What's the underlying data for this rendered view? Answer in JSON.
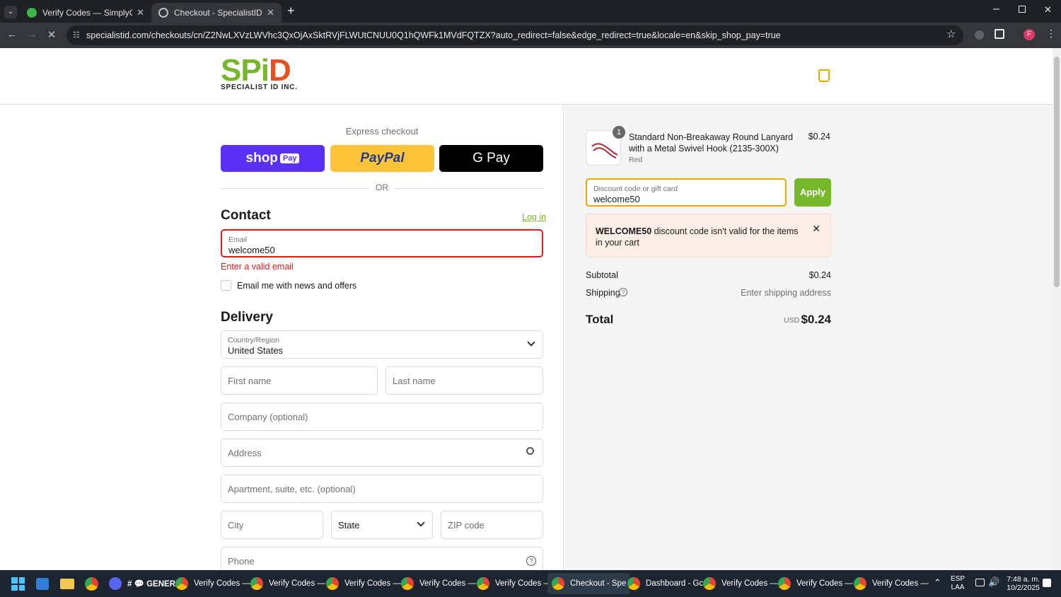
{
  "browser": {
    "tabs": [
      {
        "title": "Verify Codes — SimplyCodes",
        "close": "✕"
      },
      {
        "title": "Checkout - SpecialistID.com",
        "close": "✕"
      }
    ],
    "new_tab": "+",
    "url": "specialistid.com/checkouts/cn/Z2NwLXVzLWVhc3QxOjAxSktRVjFLWUtCNUU0Q1hQWFk1MVdFQTZX?auto_redirect=false&edge_redirect=true&locale=en&skip_shop_pay=true",
    "profile_initial": "F"
  },
  "header": {
    "logo_main": "SP",
    "logo_i": "i",
    "logo_d": "D",
    "logo_sub": "SPECIALIST ID INC."
  },
  "checkout": {
    "express_label": "Express checkout",
    "shop_pay": "shop",
    "shop_pay_badge": "Pay",
    "paypal": "PayPal",
    "gpay": "G Pay",
    "or": "OR",
    "contact_heading": "Contact",
    "login_link": "Log in",
    "email_label": "Email",
    "email_value": "welcome50",
    "email_error": "Enter a valid email",
    "newsletter_label": "Email me with news and offers",
    "delivery_heading": "Delivery",
    "country_label": "Country/Region",
    "country_value": "United States",
    "first_name": "First name",
    "last_name": "Last name",
    "company": "Company (optional)",
    "address": "Address",
    "apartment": "Apartment, suite, etc. (optional)",
    "city": "City",
    "state": "State",
    "zip": "ZIP code",
    "phone": "Phone"
  },
  "summary": {
    "item_qty": "1",
    "item_name": "Standard Non-Breakaway Round Lanyard with a Metal Swivel Hook (2135-300X)",
    "item_variant": "Red",
    "item_price": "$0.24",
    "discount_label": "Discount code or gift card",
    "discount_value": "welcome50",
    "apply": "Apply",
    "error_code": "WELCOME50",
    "error_text": " discount code isn't valid for the items in your cart",
    "subtotal_label": "Subtotal",
    "subtotal_value": "$0.24",
    "shipping_label": "Shipping",
    "shipping_value": "Enter shipping address",
    "total_label": "Total",
    "total_currency": "USD",
    "total_value": "$0.24"
  },
  "taskbar": {
    "items": [
      {
        "label": "# 💬 GENER/"
      },
      {
        "label": "Verify Codes —"
      },
      {
        "label": "Verify Codes —"
      },
      {
        "label": "Verify Codes —"
      },
      {
        "label": "Verify Codes —"
      },
      {
        "label": "Verify Codes —"
      },
      {
        "label": "Checkout - Spe"
      },
      {
        "label": "Dashboard - Gc"
      },
      {
        "label": "Verify Codes —"
      },
      {
        "label": "Verify Codes —"
      },
      {
        "label": "Verify Codes —"
      }
    ],
    "lang_top": "ESP",
    "lang_bottom": "LAA",
    "time": "7:48 a. m.",
    "date": "10/2/2025"
  },
  "colors": {
    "accent_green": "#76b82a",
    "error_red": "#dd1d1d",
    "shop_purple": "#5a31f4",
    "paypal_yellow": "#ffc439"
  }
}
